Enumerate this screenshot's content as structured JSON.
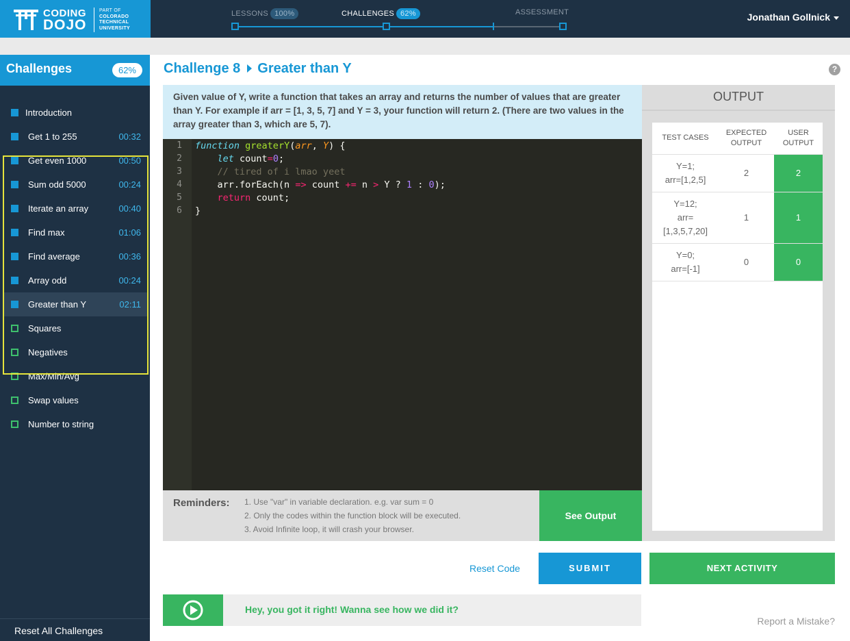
{
  "brand": {
    "line1": "CODING",
    "line2": "DOJO",
    "part_of": [
      "PART OF",
      "COLORADO",
      "TECHNICAL",
      "UNIVERSITY"
    ]
  },
  "progress": {
    "lessons": {
      "label": "LESSONS",
      "badge": "100%"
    },
    "challenges": {
      "label": "CHALLENGES",
      "badge": "62%"
    },
    "assessment": {
      "label": "ASSESSMENT"
    },
    "level": 0.78
  },
  "user": {
    "name": "Jonathan Gollnick"
  },
  "sidebar": {
    "title": "Challenges",
    "badge": "62%",
    "items": [
      {
        "label": "Introduction",
        "time": "",
        "done": true
      },
      {
        "label": "Get 1 to 255",
        "time": "00:32",
        "done": true
      },
      {
        "label": "Get even 1000",
        "time": "00:50",
        "done": true
      },
      {
        "label": "Sum odd 5000",
        "time": "00:24",
        "done": true
      },
      {
        "label": "Iterate an array",
        "time": "00:40",
        "done": true
      },
      {
        "label": "Find max",
        "time": "01:06",
        "done": true
      },
      {
        "label": "Find average",
        "time": "00:36",
        "done": true
      },
      {
        "label": "Array odd",
        "time": "00:24",
        "done": true
      },
      {
        "label": "Greater than Y",
        "time": "02:11",
        "done": true
      },
      {
        "label": "Squares",
        "time": "",
        "done": false
      },
      {
        "label": "Negatives",
        "time": "",
        "done": false
      },
      {
        "label": "Max/Min/Avg",
        "time": "",
        "done": false
      },
      {
        "label": "Swap values",
        "time": "",
        "done": false
      },
      {
        "label": "Number to string",
        "time": "",
        "done": false
      }
    ],
    "reset_label": "Reset All Challenges"
  },
  "challenge": {
    "number": "Challenge 8",
    "name": "Greater than Y",
    "description": "Given value of Y, write a function that takes an array and returns the number of values that are greater than Y. For example if arr = [1, 3, 5, 7] and Y = 3, your function will return 2. (There are two values in the array greater than 3, which are 5, 7)."
  },
  "editor": {
    "line_numbers": [
      "1",
      "2",
      "3",
      "4",
      "5",
      "6"
    ],
    "code": [
      "function greaterY(arr, Y) {",
      "    let count=0;",
      "    // tired of i lmao yeet",
      "    arr.forEach(n => count += n > Y ? 1 : 0);",
      "    return count;",
      "}"
    ]
  },
  "reminders": {
    "title": "Reminders:",
    "items": [
      "1. Use \"var\" in variable declaration. e.g. var sum = 0",
      "2. Only the codes within the function block will be executed.",
      "3. Avoid Infinite loop, it will crash your browser."
    ]
  },
  "output": {
    "title": "OUTPUT",
    "headers": [
      "TEST CASES",
      "EXPECTED OUTPUT",
      "USER OUTPUT"
    ],
    "rows": [
      {
        "case": [
          "Y=1;",
          "arr=[1,2,5]"
        ],
        "expected": "2",
        "user": "2"
      },
      {
        "case": [
          "Y=12;",
          "arr=",
          "[1,3,5,7,20]"
        ],
        "expected": "1",
        "user": "1"
      },
      {
        "case": [
          "Y=0;",
          "arr=[-1]"
        ],
        "expected": "0",
        "user": "0"
      }
    ]
  },
  "actions": {
    "see_output": "See Output",
    "reset_code": "Reset Code",
    "submit": "SUBMIT",
    "next": "NEXT ACTIVITY",
    "report": "Report a Mistake?"
  },
  "hint": {
    "text": "Hey, you got it right! Wanna see how we did it?"
  },
  "colors": {
    "primary": "#1797d5",
    "success": "#38b560",
    "dark": "#1e3144",
    "highlight": "#e6e43b"
  }
}
